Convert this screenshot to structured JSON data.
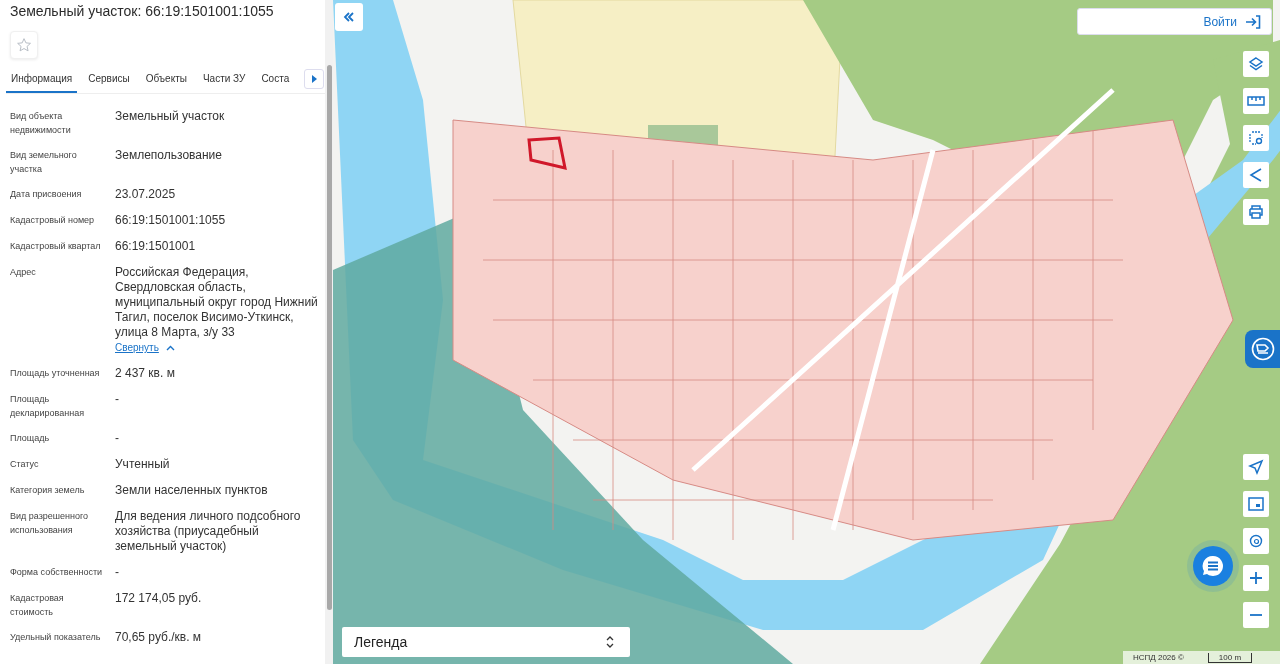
{
  "panel": {
    "title": "Земельный участок: 66:19:1501001:1055",
    "tabs": [
      {
        "label": "Информация",
        "selected": true
      },
      {
        "label": "Сервисы",
        "selected": false
      },
      {
        "label": "Объекты",
        "selected": false
      },
      {
        "label": "Части ЗУ",
        "selected": false
      },
      {
        "label": "Соста",
        "selected": false
      }
    ],
    "fields": [
      {
        "label": "Вид объекта недвижимости",
        "value": "Земельный участок"
      },
      {
        "label": "Вид земельного участка",
        "value": "Землепользование"
      },
      {
        "label": "Дата присвоения",
        "value": "23.07.2025"
      },
      {
        "label": "Кадастровый номер",
        "value": "66:19:1501001:1055"
      },
      {
        "label": "Кадастровый квартал",
        "value": "66:19:1501001"
      },
      {
        "label": "Адрес",
        "value": "Российская Федерация, Свердловская область, муниципальный округ город Нижний Тагил, поселок Висимо-Уткинск, улица 8 Марта, з/у 33",
        "link": "Свернуть"
      },
      {
        "label": "Площадь уточненная",
        "value": "2 437 кв. м"
      },
      {
        "label": "Площадь декларированная",
        "value": "-"
      },
      {
        "label": "Площадь",
        "value": "-"
      },
      {
        "label": "Статус",
        "value": "Учтенный"
      },
      {
        "label": "Категория земель",
        "value": "Земли населенных пунктов"
      },
      {
        "label": "Вид разрешенного использования",
        "value": "Для ведения личного подсобного хозяйства (приусадебный земельный участок)"
      },
      {
        "label": "Форма собственности",
        "value": "-"
      },
      {
        "label": "Кадастровая стоимость",
        "value": "172 174,05 руб."
      },
      {
        "label": "Удельный показатель",
        "value": "70,65 руб./кв. м"
      }
    ]
  },
  "map": {
    "login": "Войти",
    "legend": "Легенда",
    "attribution": "НСПД 2026 ©",
    "scale": "100 m"
  }
}
